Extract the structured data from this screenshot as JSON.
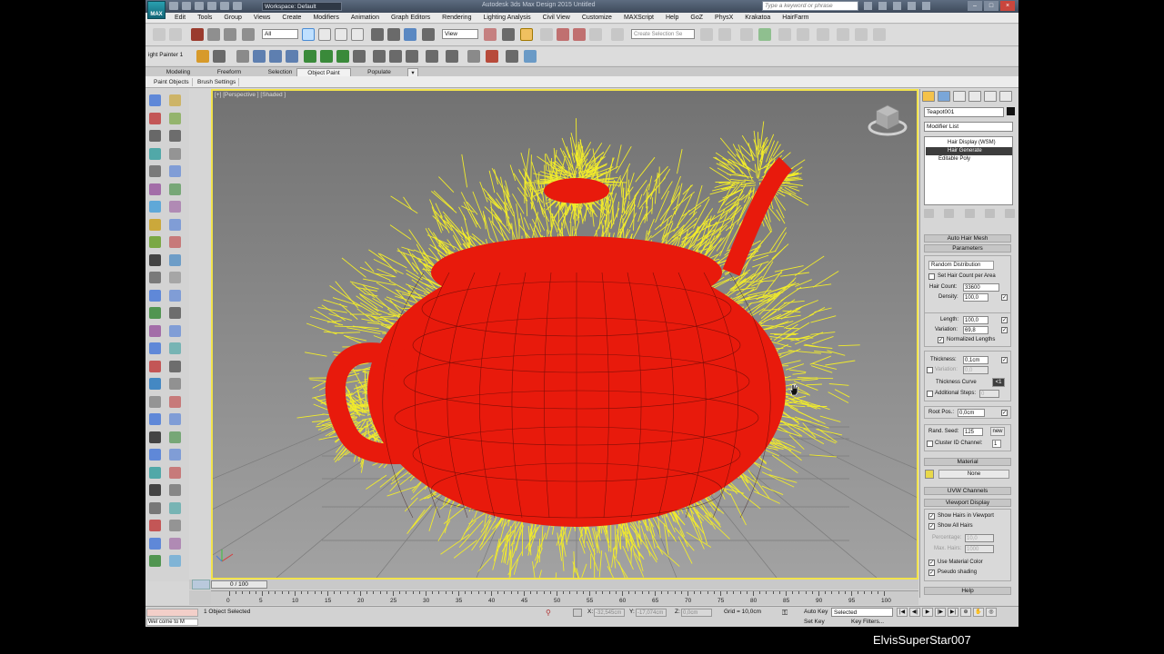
{
  "app": {
    "title": "Autodesk 3ds Max Design 2015    Untitled",
    "logo_text": "MAX",
    "workspace": "Workspace: Default",
    "search_placeholder": "Type a keyword or phrase"
  },
  "menu": [
    "Edit",
    "Tools",
    "Group",
    "Views",
    "Create",
    "Modifiers",
    "Animation",
    "Graph Editors",
    "Rendering",
    "Lighting Analysis",
    "Civil View",
    "Customize",
    "MAXScript",
    "Help",
    "GoZ",
    "PhysX",
    "Krakatoa",
    "HairFarm"
  ],
  "toolbar": {
    "selection_filter": "All",
    "reference_coord": "View",
    "named_selection_placeholder": "Create Selection Se",
    "light_painter": "ight Painter 1"
  },
  "ribbon": {
    "tabs": [
      "Modeling",
      "Freeform",
      "Selection",
      "Object Paint",
      "Populate"
    ],
    "active_tab": "Object Paint",
    "subtabs": [
      "Paint Objects",
      "Brush Settings"
    ]
  },
  "viewport": {
    "label": "[+] [Perspective ] [Shaded ]",
    "mesh_color": "#e81a0c",
    "hair_color": "#f2ec2a",
    "active_border": "#f2e34c"
  },
  "command_panel": {
    "object_name": "Teapot001",
    "modifier_list": "Modifier List",
    "stack": [
      "Hair Display (WSM)",
      "Hair Generate",
      "Editable Poly"
    ],
    "selected_stack_index": 1,
    "rollouts": {
      "auto_hair_mesh": "Auto Hair Mesh",
      "parameters": "Parameters",
      "distribution": "Random Distribution",
      "set_hair_count": "Set Hair Count per Area",
      "hair_count_label": "Hair Count:",
      "hair_count": "33600",
      "density_label": "Density:",
      "density": "100,0",
      "length_label": "Length:",
      "length": "100,0",
      "variation_label": "Variation:",
      "variation": "69,8",
      "normalized_lengths": "Normalized Lengths",
      "thickness_label": "Thickness:",
      "thickness": "0,1cm",
      "thickness_variation_label": "Variation:",
      "thickness_variation": "0,0",
      "thickness_curve": "Thickness Curve",
      "thickness_curve_btn": "<1",
      "additional_steps_label": "Additional Steps:",
      "additional_steps": "0",
      "root_pos_label": "Root Pos.:",
      "root_pos": "0,0cm",
      "rand_seed_label": "Rand. Seed:",
      "rand_seed": "125",
      "new_btn": "new",
      "cluster_label": "Cluster ID Channel:",
      "cluster": "1",
      "material": "Material",
      "material_none": "None",
      "uvw_channels": "UVW Channels",
      "viewport_display": "Viewport Display",
      "show_hairs": "Show Hairs in Viewport",
      "show_all_hairs": "Show All Hairs",
      "percentage_label": "Percentage:",
      "percentage": "10,0",
      "max_hairs_label": "Max. Hairs:",
      "max_hairs": "1000",
      "use_material_color": "Use Material Color",
      "pseudo_shading": "Pseudo shading",
      "help": "Help"
    }
  },
  "timeline": {
    "frame_indicator": "0 / 100",
    "ticks": [
      "0",
      "5",
      "10",
      "15",
      "20",
      "25",
      "30",
      "35",
      "40",
      "45",
      "50",
      "55",
      "60",
      "65",
      "70",
      "75",
      "80",
      "85",
      "90",
      "95",
      "100"
    ]
  },
  "status": {
    "maxscript_listener": "Wel come to M",
    "selection": "1 Object Selected",
    "x": "-32,545cm",
    "y": "-17,074cm",
    "z": "0,0cm",
    "grid": "Grid = 10,0cm",
    "auto_key": "Auto Key",
    "set_key": "Set Key",
    "key_mode": "Selected",
    "key_filters": "Key Filters..."
  },
  "watermark": "ElvisSuperStar007"
}
